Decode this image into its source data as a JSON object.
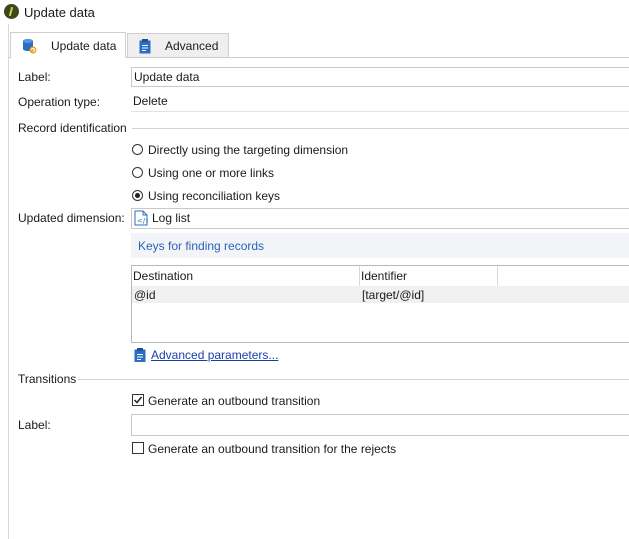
{
  "window": {
    "title": "Update data"
  },
  "tabs": [
    {
      "label": "Update data",
      "icon": "database-refresh-icon",
      "active": true
    },
    {
      "label": "Advanced",
      "icon": "clipboard-icon",
      "active": false
    }
  ],
  "form": {
    "label_caption": "Label:",
    "label_value": "Update data",
    "operation_caption": "Operation type:",
    "operation_value": "Delete"
  },
  "record_identification": {
    "title": "Record identification",
    "options": [
      {
        "label": "Directly using the targeting dimension",
        "selected": false
      },
      {
        "label": "Using one or more links",
        "selected": false
      },
      {
        "label": "Using reconciliation keys",
        "selected": true
      }
    ]
  },
  "updated_dimension": {
    "caption": "Updated dimension:",
    "value": "Log list",
    "icon": "schema-icon"
  },
  "keys": {
    "title": "Keys for finding records",
    "columns": [
      "Destination",
      "Identifier"
    ],
    "rows": [
      {
        "destination": "@id",
        "identifier": "[target/@id]"
      }
    ],
    "advanced_link": "Advanced parameters..."
  },
  "transitions": {
    "title": "Transitions",
    "generate_outbound": {
      "label": "Generate an outbound transition",
      "checked": true
    },
    "label_caption": "Label:",
    "label_value": "",
    "generate_rejects": {
      "label": "Generate an outbound transition for the rejects",
      "checked": false
    }
  },
  "colors": {
    "accent_link": "#2a62b8",
    "keys_bar_bg": "#f2f4f7",
    "icon_blue": "#2b6cc4"
  }
}
